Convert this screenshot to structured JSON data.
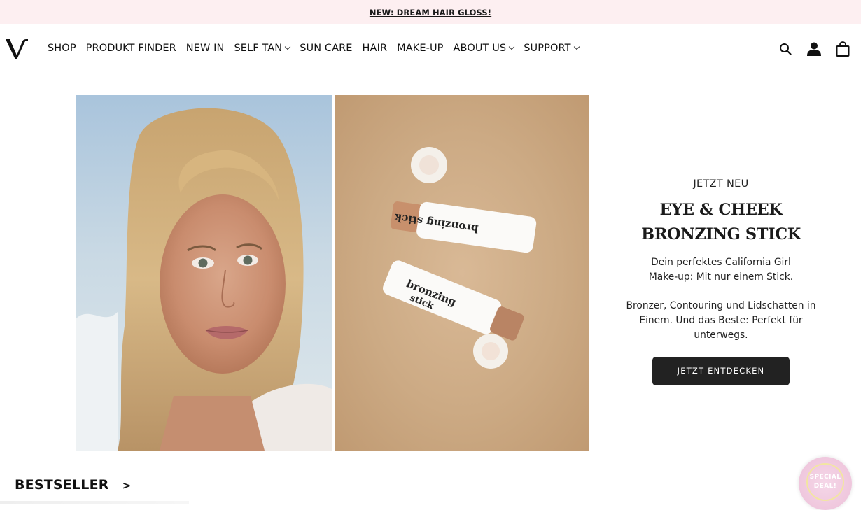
{
  "announcement": {
    "text": "NEW: DREAM HAIR GLOSS!"
  },
  "nav": {
    "logo_alt": "V",
    "items": [
      {
        "label": "SHOP",
        "has_dropdown": false
      },
      {
        "label": "PRODUKT FINDER",
        "has_dropdown": false
      },
      {
        "label": "NEW IN",
        "has_dropdown": false
      },
      {
        "label": "SELF TAN",
        "has_dropdown": true
      },
      {
        "label": "SUN CARE",
        "has_dropdown": false
      },
      {
        "label": "HAIR",
        "has_dropdown": false
      },
      {
        "label": "MAKE-UP",
        "has_dropdown": false
      },
      {
        "label": "ABOUT US",
        "has_dropdown": true
      },
      {
        "label": "SUPPORT",
        "has_dropdown": true
      }
    ],
    "icons": [
      "search-icon",
      "account-icon",
      "cart-icon"
    ]
  },
  "hero": {
    "eyebrow": "JETZT NEU",
    "headline_line1": "EYE & CHEEK",
    "headline_line2": "BRONZING STICK",
    "sub1": "Dein perfektes California Girl Make-up: Mit nur einem Stick.",
    "sub2": "Bronzer, Contouring und Lidschatten in Einem. Und das Beste: Perfekt für unterwegs.",
    "cta": "JETZT ENTDECKEN",
    "product_label": "bronzing stick"
  },
  "bestseller": {
    "label": "BESTSELLER",
    "arrow": ">"
  },
  "deal_badge": {
    "line1": "SPECIAL",
    "line2": "DEAL!"
  },
  "colors": {
    "announce_bg": "#fdeff1",
    "cta_bg": "#222222",
    "deal_pink": "#efc7dd"
  }
}
